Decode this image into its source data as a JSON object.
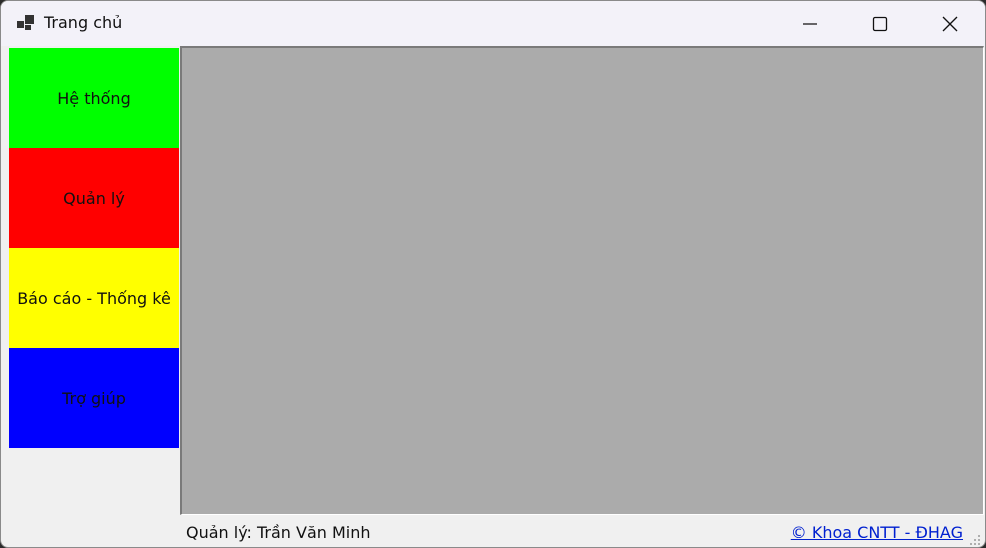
{
  "window": {
    "title": "Trang chủ"
  },
  "icons": {
    "app": "app-window-icon",
    "minimize": "minimize-icon",
    "maximize": "maximize-icon",
    "close": "close-icon",
    "grip": "resize-grip-icon"
  },
  "sidebar": {
    "items": [
      {
        "label": "Hệ thống",
        "color": "#00ff00"
      },
      {
        "label": "Quản lý",
        "color": "#ff0000"
      },
      {
        "label": "Báo cáo - Thống kê",
        "color": "#ffff00"
      },
      {
        "label": "Trợ giúp",
        "color": "#0000ff"
      }
    ]
  },
  "content": {
    "background": "#ababab"
  },
  "status": {
    "user_text": "Quản lý: Trần Văn Minh",
    "link_text": "© Khoa CNTT - ĐHAG",
    "link_color": "#0020d0"
  }
}
